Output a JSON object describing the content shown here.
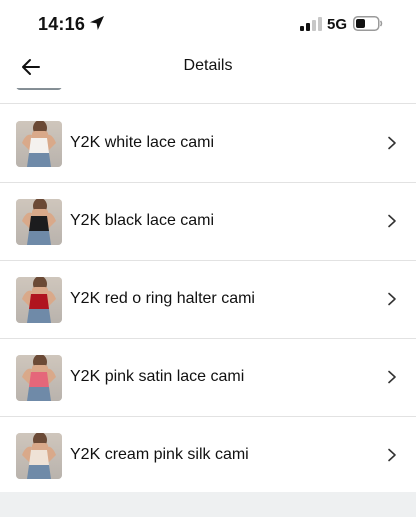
{
  "status_bar": {
    "time": "14:16",
    "network": "5G",
    "icons": [
      "location-arrow-icon",
      "signal-bars-icon",
      "battery-icon"
    ]
  },
  "nav": {
    "title": "Details",
    "back_icon": "arrow-left-icon"
  },
  "items": [
    {
      "label": "Y2K white lace cami",
      "top_color": "#f4f1ee"
    },
    {
      "label": "Y2K black lace cami",
      "top_color": "#1c1c1e"
    },
    {
      "label": "Y2K red o ring halter cami",
      "top_color": "#b0141f"
    },
    {
      "label": "Y2K pink satin lace cami",
      "top_color": "#e5677a"
    },
    {
      "label": "Y2K cream pink silk cami",
      "top_color": "#efe2d6"
    }
  ],
  "colors": {
    "divider": "#e2e2e2",
    "bottom_area": "#eef0f1"
  }
}
